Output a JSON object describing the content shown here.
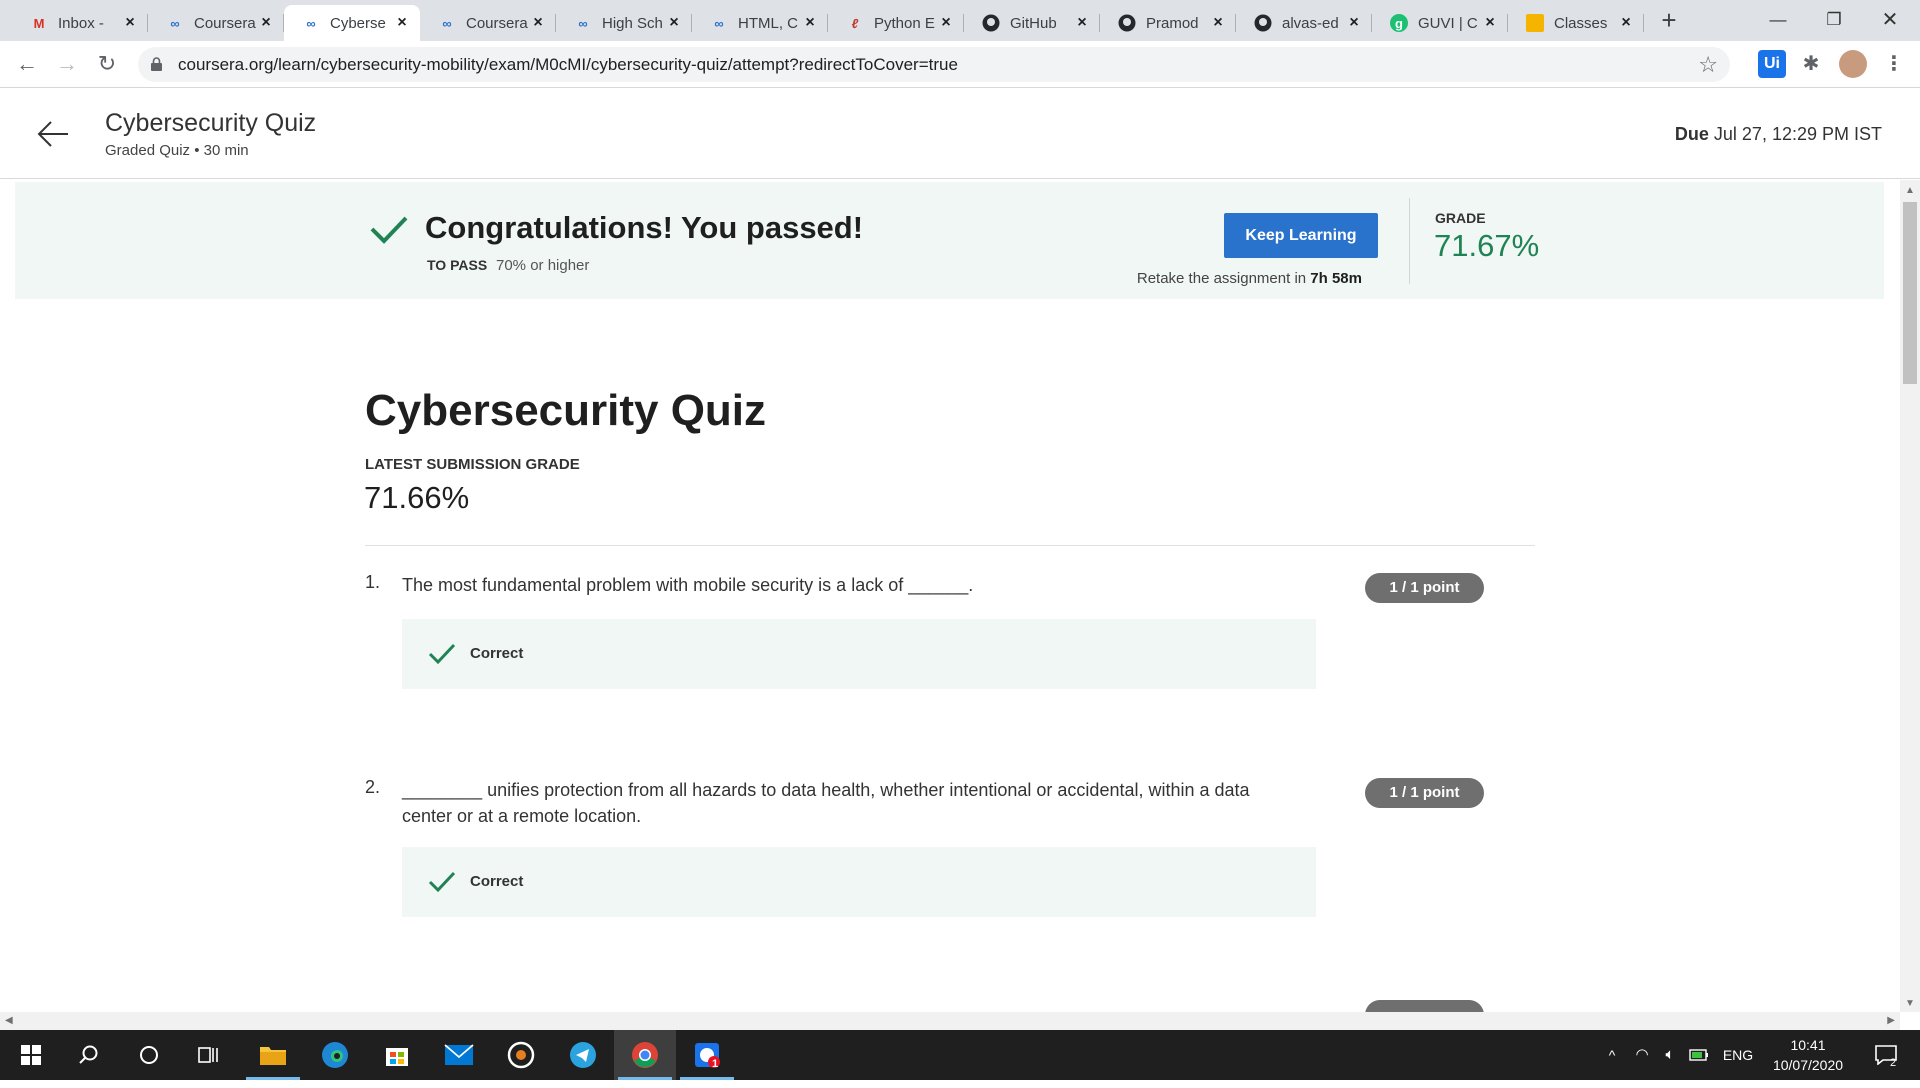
{
  "browser": {
    "tabs": [
      {
        "label": "Inbox - ",
        "icon": "gmail-icon"
      },
      {
        "label": "Coursera",
        "icon": "coursera-icon"
      },
      {
        "label": "Cyberse",
        "icon": "coursera-icon",
        "active": true
      },
      {
        "label": "Coursera",
        "icon": "coursera-icon"
      },
      {
        "label": "High Sch",
        "icon": "coursera-icon"
      },
      {
        "label": "HTML, C",
        "icon": "coursera-icon"
      },
      {
        "label": "Python E",
        "icon": "python-tutor-icon"
      },
      {
        "label": "GitHub",
        "icon": "github-icon"
      },
      {
        "label": "Pramod",
        "icon": "github-icon"
      },
      {
        "label": "alvas-ed",
        "icon": "github-icon"
      },
      {
        "label": "GUVI | C",
        "icon": "guvi-icon"
      },
      {
        "label": "Classes",
        "icon": "classroom-icon"
      }
    ],
    "new_tab": "+",
    "url": "coursera.org/learn/cybersecurity-mobility/exam/M0cMI/cybersecurity-quiz/attempt?redirectToCover=true",
    "extension_label": "Ui"
  },
  "header": {
    "title": "Cybersecurity Quiz",
    "subtitle": "Graded Quiz • 30 min",
    "due_label": "Due",
    "due_value": "Jul 27, 12:29 PM IST"
  },
  "banner": {
    "title": "Congratulations! You passed!",
    "to_pass_label": "TO PASS",
    "to_pass_value": "70% or higher",
    "button_label": "Keep Learning",
    "retake_text": "Retake the assignment in",
    "retake_time": "7h 58m",
    "grade_label": "GRADE",
    "grade_value": "71.67%"
  },
  "main": {
    "title": "Cybersecurity Quiz",
    "latest_label": "LATEST SUBMISSION GRADE",
    "latest_value": "71.66%",
    "questions": [
      {
        "number": "1.",
        "text": "The most fundamental problem with mobile security is a lack of ______.",
        "points": "1 / 1 point",
        "feedback": "Correct"
      },
      {
        "number": "2.",
        "text": "________ unifies protection from all hazards to data health, whether intentional or accidental, within a data center or at a remote location.",
        "points": "1 / 1 point",
        "feedback": "Correct"
      }
    ]
  },
  "taskbar": {
    "language": "ENG",
    "time": "10:41",
    "date": "10/07/2020",
    "notification_count": "2",
    "app_badge": "1"
  },
  "colors": {
    "primary_button": "#2a73cc",
    "success_green": "#1f8354",
    "banner_bg": "#f1f7f5",
    "points_pill": "#6f6f6f"
  }
}
